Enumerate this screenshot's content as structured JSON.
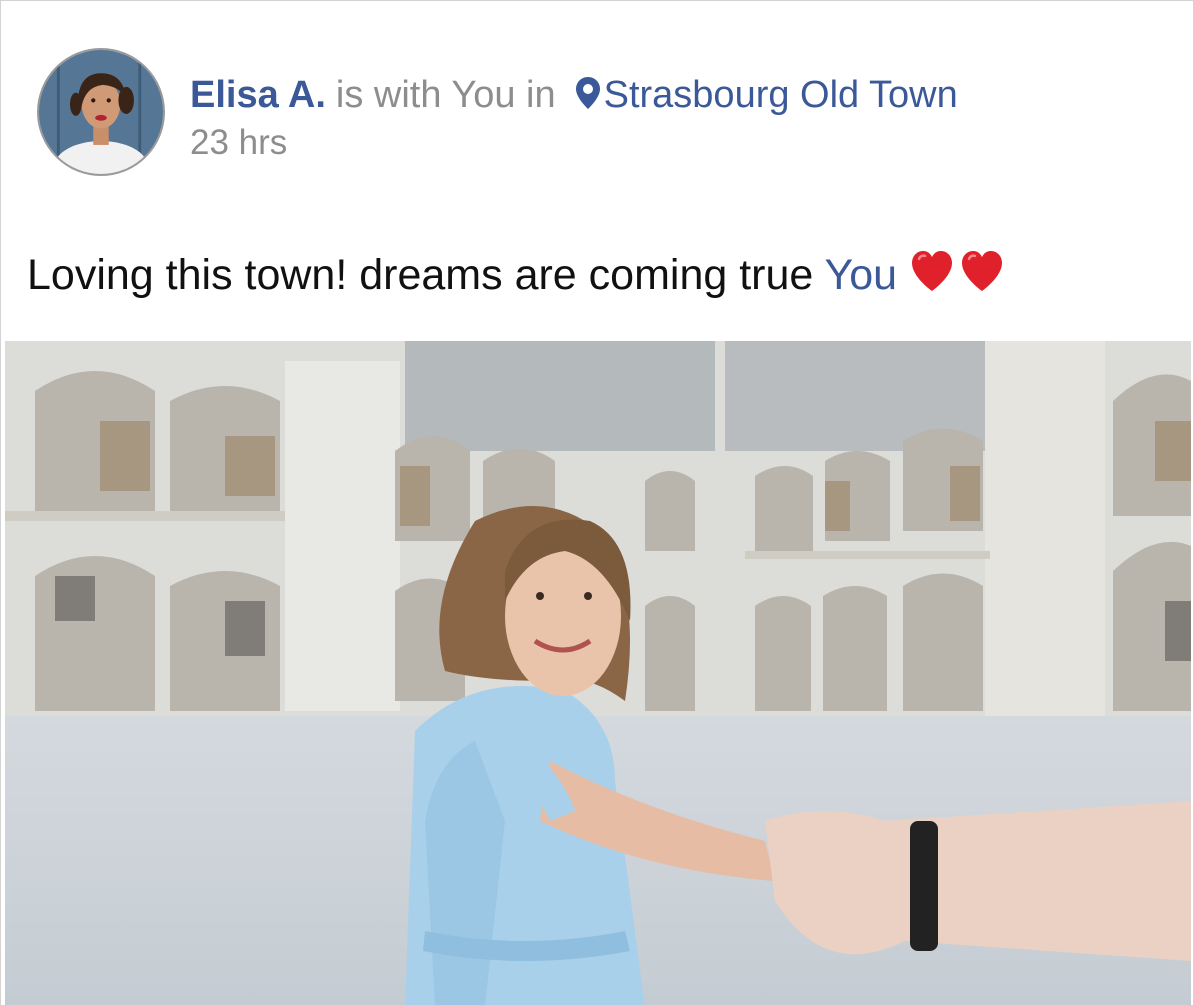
{
  "post": {
    "author": "Elisa A.",
    "with_text": "is with You in",
    "location": "Strasbourg Old Town",
    "timestamp": "23 hrs",
    "body_text": "Loving this town! dreams are coming true",
    "tagged_user": "You",
    "emoji": [
      "red-heart-icon",
      "red-heart-icon"
    ]
  },
  "colors": {
    "link": "#3b5998",
    "meta_text": "#8d8d8d",
    "heart": "#e0202a"
  }
}
